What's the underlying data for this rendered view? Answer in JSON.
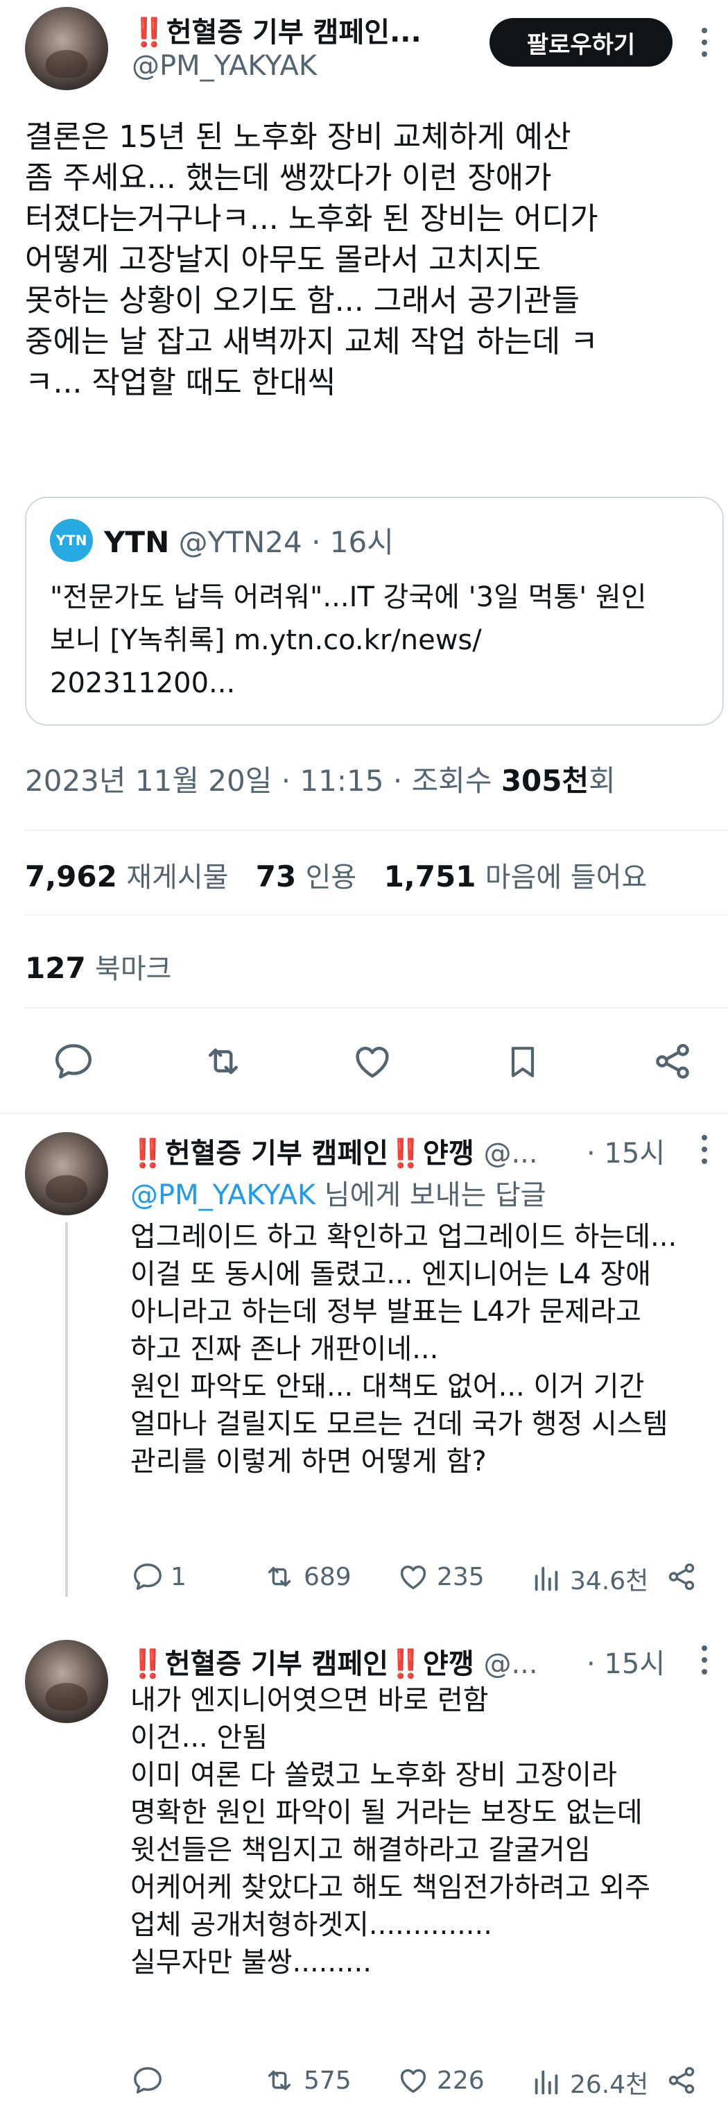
{
  "main_tweet": {
    "author": {
      "name_prefix": "‼️",
      "name_text": "헌혈증 기부 캠페인...",
      "handle": "@PM_YAKYAK"
    },
    "follow_button": "팔로우하기",
    "body_lines": [
      "결론은 15년 된 노후화 장비 교체하게 예산",
      "좀 주세요... 했는데 쌩깠다가 이런 장애가",
      "터졌다는거구나ㅋ... 노후화 된 장비는 어디가",
      "어떻게 고장날지 아무도 몰라서 고치지도",
      "못하는 상황이 오기도 함... 그래서 공기관들",
      "중에는 날 잡고 새벽까지 교체 작업 하는데 ㅋ",
      "ㅋ... 작업할 때도 한대씩"
    ],
    "quote": {
      "logo_text": "YTN",
      "name": "YTN",
      "handle": "@YTN24",
      "time": "· 16시",
      "text_lines": [
        "\"전문가도 납득 어려워\"...IT 강국에 '3일 먹통' 원인",
        "보니 [Y녹취록] m.ytn.co.kr/news/",
        "202311200..."
      ]
    },
    "meta": {
      "datetime": "2023년 11월 20일 · 11:15 · 조회수 ",
      "views": "305천",
      "views_suffix": "회"
    },
    "stats": {
      "retweets": "7,962",
      "retweets_label": "재게시물",
      "quotes": "73",
      "quotes_label": "인용",
      "likes": "1,751",
      "likes_label": "마음에 들어요",
      "bookmarks": "127",
      "bookmarks_label": "북마크"
    }
  },
  "replies": [
    {
      "name_text": "헌혈증 기부 캠페인",
      "name_suffix": "얀깽",
      "handle": "@...",
      "time": "· 15시",
      "replying_to": "@PM_YAKYAK",
      "replying_suffix": " 님에게 보내는 답글",
      "lines": [
        "업그레이드 하고 확인하고 업그레이드 하는데...",
        "이걸 또 동시에 돌렸고... 엔지니어는 L4 장애",
        "아니라고 하는데 정부 발표는 L4가 문제라고",
        "하고 진짜 존나 개판이네...",
        "원인 파악도 안돼... 대책도 없어... 이거 기간",
        "얼마나 걸릴지도 모르는 건데 국가 행정 시스템",
        "관리를 이렇게 하면 어떻게 함?"
      ],
      "reply_count": "1",
      "retweet_count": "689",
      "like_count": "235",
      "view_count": "34.6천"
    },
    {
      "name_text": "헌혈증 기부 캠페인",
      "name_suffix": "얀깽",
      "handle": "@...",
      "time": "· 15시",
      "lines": [
        "내가 엔지니어엿으면 바로 런함",
        "이건... 안됨",
        "이미 여론 다 쏠렸고 노후화 장비 고장이라",
        "명확한 원인 파악이 될 거라는 보장도 없는데",
        "윗선들은 책임지고 해결하라고 갈굴거임",
        "어케어케 찾았다고 해도 책임전가하려고 외주",
        "업체 공개처형하겟지..............",
        "실무자만 불쌍........."
      ],
      "reply_count": "",
      "retweet_count": "575",
      "like_count": "226",
      "view_count": "26.4천"
    }
  ],
  "colors": {
    "text": "#0f1419",
    "muted": "#536471",
    "link": "#1d9bf0",
    "bang": "#e0245e",
    "divider": "#eff3f4"
  },
  "icons": [
    "more-icon",
    "reply-icon",
    "retweet-icon",
    "like-icon",
    "bookmark-icon",
    "share-icon",
    "views-icon"
  ]
}
